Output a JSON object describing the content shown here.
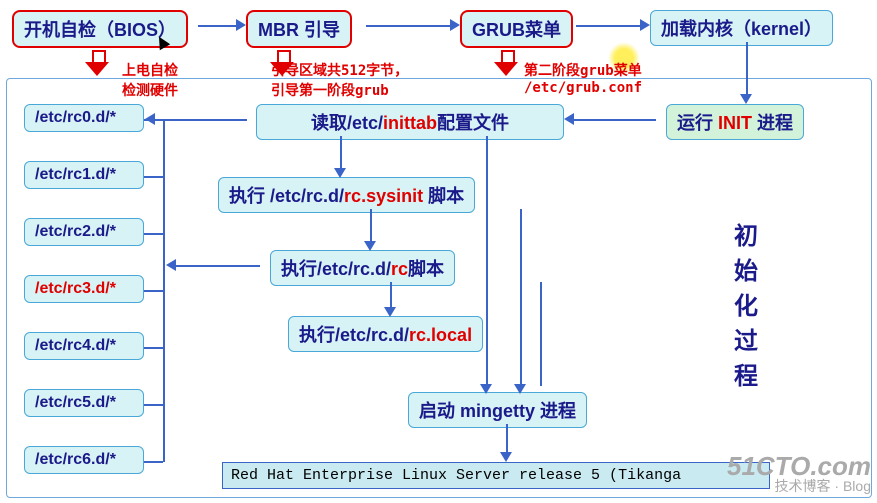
{
  "top": {
    "bios": "开机自检（BIOS）",
    "mbr_pre": "MBR",
    "mbr_post": "引导",
    "grub": "GRUB菜单",
    "kernel": "加载内核（kernel）"
  },
  "ann": {
    "bios1": "上电自检",
    "bios2": "检测硬件",
    "mbr1": "引导区域共512字节，",
    "mbr2": "引导第一阶段grub",
    "grub1": "第二阶段grub菜单",
    "grub2": "/etc/grub.conf"
  },
  "init": {
    "pre": "运行",
    "mid": "INIT",
    "post": "进程"
  },
  "read": {
    "pre": "读取",
    "path": "/etc/",
    "file": "inittab",
    "post": "配置文件"
  },
  "sys": {
    "pre": "执行",
    "path": "/etc/rc.d/",
    "file": "rc.sysinit",
    "post": "脚本"
  },
  "rc": {
    "pre": "执行",
    "path": "/etc/rc.d/",
    "file": "rc",
    "post": "脚本"
  },
  "local": {
    "pre": "执行",
    "path": "/etc/rc.d/",
    "file": "rc.local"
  },
  "ming": {
    "pre": "启动",
    "mid": "mingetty",
    "post": "进程"
  },
  "rcn": [
    "/etc/rc0.d/*",
    "/etc/rc1.d/*",
    "/etc/rc2.d/*",
    "/etc/rc3.d/*",
    "/etc/rc4.d/*",
    "/etc/rc5.d/*",
    "/etc/rc6.d/*"
  ],
  "side": "初始化过程",
  "terminal": "Red Hat Enterprise Linux Server release 5 (Tikanga",
  "wm": {
    "big": "51CTO.com",
    "small": "技术博客 · Blog"
  }
}
